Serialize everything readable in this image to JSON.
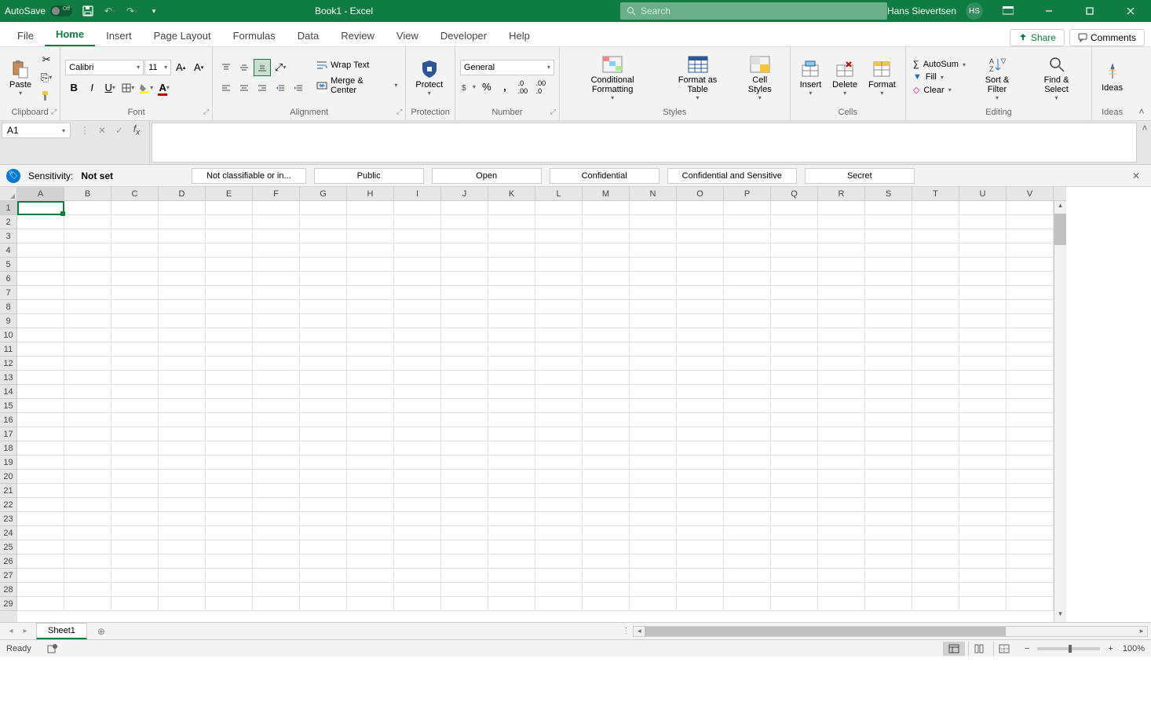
{
  "titlebar": {
    "autosave_label": "AutoSave",
    "autosave_state": "Off",
    "doc_title": "Book1 - Excel",
    "search_placeholder": "Search",
    "user_name": "Hans Sievertsen",
    "user_initials": "HS"
  },
  "tabs": {
    "items": [
      "File",
      "Home",
      "Insert",
      "Page Layout",
      "Formulas",
      "Data",
      "Review",
      "View",
      "Developer",
      "Help"
    ],
    "active": "Home",
    "share_label": "Share",
    "comments_label": "Comments"
  },
  "ribbon": {
    "clipboard": {
      "label": "Clipboard",
      "paste": "Paste"
    },
    "font": {
      "label": "Font",
      "name": "Calibri",
      "size": "11"
    },
    "alignment": {
      "label": "Alignment",
      "wrap": "Wrap Text",
      "merge": "Merge & Center"
    },
    "protection": {
      "label": "Protection",
      "protect": "Protect"
    },
    "number": {
      "label": "Number",
      "format": "General"
    },
    "styles": {
      "label": "Styles",
      "cond": "Conditional Formatting",
      "table": "Format as Table",
      "cell": "Cell Styles"
    },
    "cells": {
      "label": "Cells",
      "insert": "Insert",
      "delete": "Delete",
      "format": "Format"
    },
    "editing": {
      "label": "Editing",
      "autosum": "AutoSum",
      "fill": "Fill",
      "clear": "Clear",
      "sort": "Sort & Filter",
      "find": "Find & Select"
    },
    "ideas": {
      "label": "Ideas",
      "ideas": "Ideas"
    }
  },
  "namebox": {
    "value": "A1"
  },
  "sensitivity": {
    "label": "Sensitivity:",
    "value": "Not set",
    "options": [
      "Not classifiable or in...",
      "Public",
      "Open",
      "Confidential",
      "Confidential and Sensitive",
      "Secret"
    ]
  },
  "grid": {
    "cols": [
      "A",
      "B",
      "C",
      "D",
      "E",
      "F",
      "G",
      "H",
      "I",
      "J",
      "K",
      "L",
      "M",
      "N",
      "O",
      "P",
      "Q",
      "R",
      "S",
      "T",
      "U",
      "V"
    ],
    "rows": 29,
    "selected_col": "A",
    "selected_row": 1
  },
  "sheets": {
    "active": "Sheet1"
  },
  "status": {
    "ready": "Ready",
    "zoom": "100%"
  }
}
